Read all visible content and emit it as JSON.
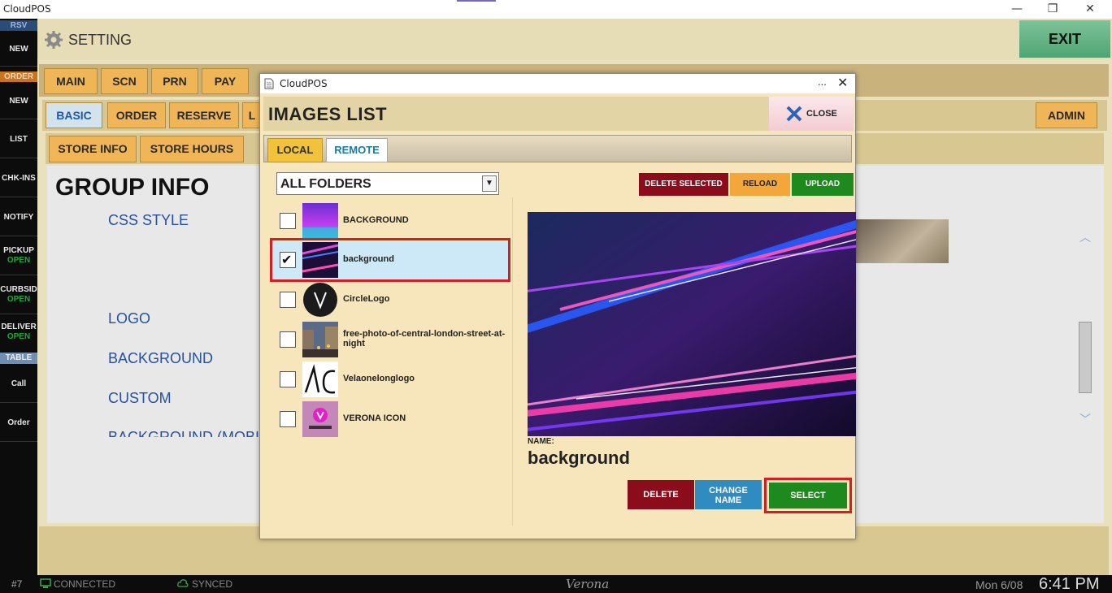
{
  "os": {
    "title": "CloudPOS",
    "minimize": "—",
    "restore": "❐",
    "close": "✕"
  },
  "sidebar": {
    "rsv_header": "RSV",
    "rsv_new": "NEW",
    "order_header": "ORDER",
    "order_new": "NEW",
    "list": "LIST",
    "chkins": "CHK-INS",
    "notify": "NOTIFY",
    "pickup": "PICKUP",
    "pickup_status": "OPEN",
    "curbside": "CURBSID",
    "curbside_status": "OPEN",
    "delivery": "DELIVER",
    "delivery_status": "OPEN",
    "table_header": "TABLE",
    "call": "Call",
    "order": "Order",
    "colors": {
      "rsv": "#2a4c7a",
      "order": "#c8741f",
      "table": "#6f8fb0"
    }
  },
  "header": {
    "title": "SETTING",
    "exit": "EXIT"
  },
  "tabs_main": [
    "MAIN",
    "SCN",
    "PRN",
    "PAY"
  ],
  "tabs_sub": {
    "basic": "BASIC",
    "order": "ORDER",
    "reserve": "RESERVE",
    "partial": "L",
    "admin": "ADMIN"
  },
  "tabs_section": {
    "store_info": "STORE INFO",
    "store_hours": "STORE HOURS"
  },
  "content": {
    "group_title": "GROUP INFO",
    "css_style": "CSS STYLE",
    "logo": "LOGO",
    "background": "BACKGROUND",
    "custom": "CUSTOM",
    "background_mobile": "BACKGROUND (MOBI"
  },
  "status": {
    "station": "#7",
    "connected": "CONNECTED",
    "synced": "SYNCED",
    "brand": "Verona",
    "date": "Mon 6/08",
    "time": "6:41 PM"
  },
  "dialog": {
    "app_title": "CloudPOS",
    "more": "...",
    "close_x": "✕",
    "heading": "IMAGES LIST",
    "close_label": "CLOSE",
    "tab_local": "LOCAL",
    "tab_remote": "REMOTE",
    "folder_selected": "ALL FOLDERS",
    "delete_selected": "DELETE SELECTED",
    "reload": "RELOAD",
    "upload": "UPLOAD",
    "images": [
      {
        "name": "BACKGROUND",
        "checked": false,
        "icon": "purple-gradient-thumbnail"
      },
      {
        "name": "background",
        "checked": true,
        "icon": "neon-streak-thumbnail"
      },
      {
        "name": "CircleLogo",
        "checked": false,
        "icon": "circle-v-logo-thumbnail"
      },
      {
        "name": "free-photo-of-central-london-street-at-night",
        "checked": false,
        "icon": "street-photo-thumbnail"
      },
      {
        "name": "Velaonelonglogo",
        "checked": false,
        "icon": "long-logo-thumbnail"
      },
      {
        "name": "VERONA ICON",
        "checked": false,
        "icon": "verona-icon-thumbnail"
      }
    ],
    "check_mark": "✔",
    "name_label": "NAME:",
    "name_value": "background",
    "delete": "DELETE",
    "change_name_1": "CHANGE",
    "change_name_2": "NAME",
    "select": "SELECT",
    "highlight_color": "#d21f26"
  }
}
